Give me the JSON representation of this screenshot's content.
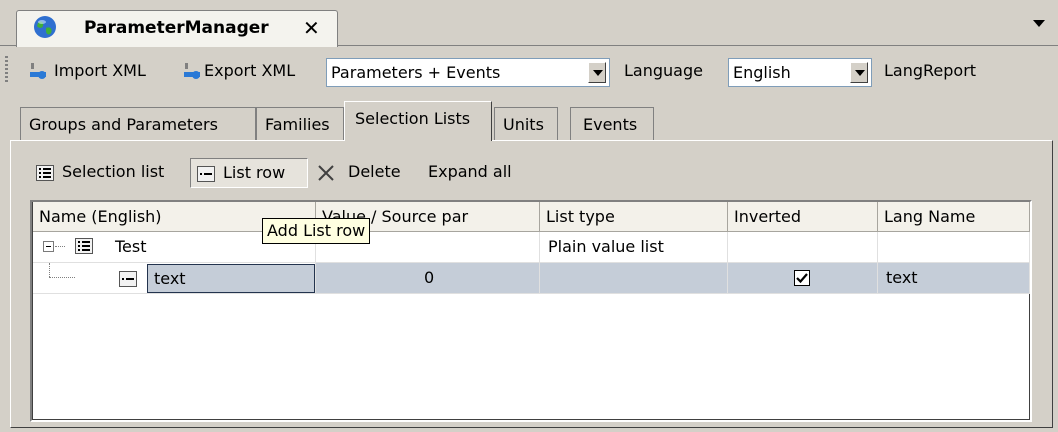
{
  "doc_tab": {
    "title": "ParameterManager",
    "close_glyph": "✕"
  },
  "toolbar": {
    "import_xml": "Import XML",
    "export_xml": "Export XML",
    "scope_select": {
      "value": "Parameters + Events"
    },
    "language_label": "Language",
    "language_select": {
      "value": "English"
    },
    "lang_report": "LangReport"
  },
  "subtabs": [
    {
      "label": "Groups and Parameters"
    },
    {
      "label": "Families"
    },
    {
      "label": "Selection Lists",
      "active": true
    },
    {
      "label": "Units"
    },
    {
      "label": "Events"
    }
  ],
  "list_toolbar": {
    "selection_list": "Selection list",
    "list_row": "List row",
    "delete": "Delete",
    "expand_all": "Expand all"
  },
  "grid": {
    "columns": [
      "Name (English)",
      "Value / Source par",
      "List type",
      "Inverted",
      "Lang Name"
    ],
    "rows": [
      {
        "name": "Test",
        "value": "",
        "list_type": "Plain value list",
        "inverted": false,
        "lang_name": ""
      },
      {
        "name": "text",
        "value": "0",
        "list_type": "",
        "inverted": true,
        "lang_name": "text"
      }
    ]
  },
  "tooltip": "Add List row",
  "colors": {
    "selection_row": "#c5cdd8",
    "tooltip_bg": "#ffffe1",
    "chrome": "#d4d0c8"
  },
  "icons": [
    "globe-icon",
    "close-icon",
    "plug-icon",
    "list-icon",
    "list-row-icon",
    "delete-x-icon",
    "tree-collapse-icon",
    "checkbox-icon"
  ]
}
